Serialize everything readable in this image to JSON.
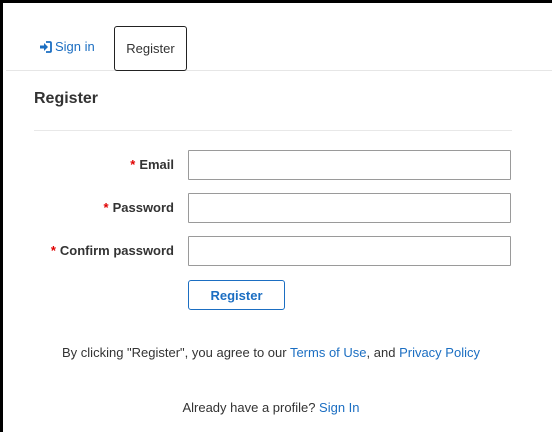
{
  "tabs": {
    "sign_in_label": "Sign in",
    "register_label": "Register"
  },
  "page": {
    "title": "Register"
  },
  "form": {
    "required_marker": "*",
    "email": {
      "label": "Email",
      "value": ""
    },
    "password": {
      "label": "Password",
      "value": ""
    },
    "confirm_password": {
      "label": "Confirm password",
      "value": ""
    },
    "submit_label": "Register"
  },
  "agreement": {
    "prefix": "By clicking \"Register\", you agree to our ",
    "terms_link": "Terms of Use",
    "middle": ", and ",
    "privacy_link": "Privacy Policy"
  },
  "signin_prompt": {
    "text": "Already have a profile? ",
    "link": "Sign In"
  },
  "icons": {
    "sign_in": "sign-in-icon"
  },
  "colors": {
    "link": "#1b6ec2",
    "required": "#e00000",
    "text": "#333333"
  }
}
